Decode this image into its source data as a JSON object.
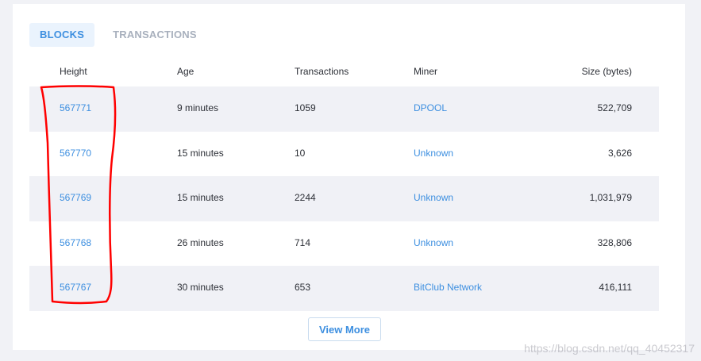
{
  "tabs": [
    {
      "label": "BLOCKS",
      "active": true
    },
    {
      "label": "TRANSACTIONS",
      "active": false
    }
  ],
  "table": {
    "columns": [
      "Height",
      "Age",
      "Transactions",
      "Miner",
      "Size (bytes)"
    ],
    "rows": [
      {
        "height": "567771",
        "age": "9 minutes",
        "transactions": "1059",
        "miner": "DPOOL",
        "size": "522,709"
      },
      {
        "height": "567770",
        "age": "15 minutes",
        "transactions": "10",
        "miner": "Unknown",
        "size": "3,626"
      },
      {
        "height": "567769",
        "age": "15 minutes",
        "transactions": "2244",
        "miner": "Unknown",
        "size": "1,031,979"
      },
      {
        "height": "567768",
        "age": "26 minutes",
        "transactions": "714",
        "miner": "Unknown",
        "size": "328,806"
      },
      {
        "height": "567767",
        "age": "30 minutes",
        "transactions": "653",
        "miner": "BitClub Network",
        "size": "416,111"
      }
    ]
  },
  "view_more_label": "View More",
  "watermark": "https://blog.csdn.net/qq_40452317",
  "colors": {
    "accent": "#3d8fe0",
    "annotation": "#ff0000",
    "row_shade": "#f0f1f6"
  }
}
